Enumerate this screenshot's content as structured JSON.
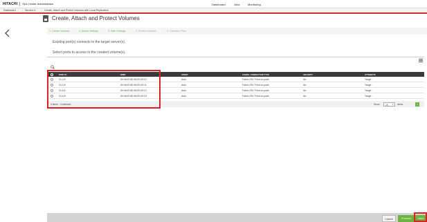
{
  "header": {
    "logo": "HITACHI",
    "app_name": "Ops Center Administrator",
    "nav": [
      "Dashboard",
      "Jobs",
      "Monitoring"
    ]
  },
  "breadcrumb": {
    "items": [
      "Dashboard",
      "Servers ▾",
      "Create, Attach and Protect Volumes with Local Replication"
    ]
  },
  "page": {
    "title": "Create, Attach and Protect Volumes"
  },
  "steps": [
    {
      "label": "1. Create Volumes",
      "state": "done"
    },
    {
      "label": "2. Attach Settings",
      "state": "done"
    },
    {
      "label": "3. Path Settings",
      "state": "active"
    },
    {
      "label": "4. Protect Volumes",
      "state": "pending"
    },
    {
      "label": "5. Operation Plan",
      "state": "pending"
    }
  ],
  "intro": {
    "line1": "Existing port(s) connects to the target server(s).",
    "dash": "--",
    "line2": "Select ports to access to the created volume(s)."
  },
  "search": {
    "placeholder": ""
  },
  "table": {
    "headers": [
      "PORT ID",
      "WWN",
      "SPEED",
      "FABRIC, CONNECTION TYPE",
      "SECURITY",
      "ATTRIBUTE"
    ],
    "rows": [
      [
        "CL1-B",
        "50:06:0E:80:08:ED:40:01",
        "Auto",
        "Fabric ON / Point-to-point",
        "No",
        "Target"
      ],
      [
        "CL2-B",
        "50:06:0E:80:08:ED:40:11",
        "Auto",
        "Fabric ON / Point-to-point",
        "No",
        "Target"
      ],
      [
        "CL3-B",
        "50:06:0E:80:08:ED:40:21",
        "Auto",
        "Fabric ON / Point-to-point",
        "No",
        "Target"
      ],
      [
        "CL4-B",
        "50:06:0E:80:08:ED:40:31",
        "Auto",
        "Fabric ON / Point-to-point",
        "No",
        "Target"
      ]
    ],
    "footer_count": "4 items · 4 selected",
    "show_label": "Show",
    "show_value": "25",
    "items_label": "items",
    "page_number": "1"
  },
  "buttons": {
    "cancel": "Cancel",
    "previous": "Previous",
    "next": "Next"
  },
  "colors": {
    "accent_green": "#6cb33f",
    "highlight_red": "#e01e24",
    "header_dark": "#3b3b3b"
  }
}
